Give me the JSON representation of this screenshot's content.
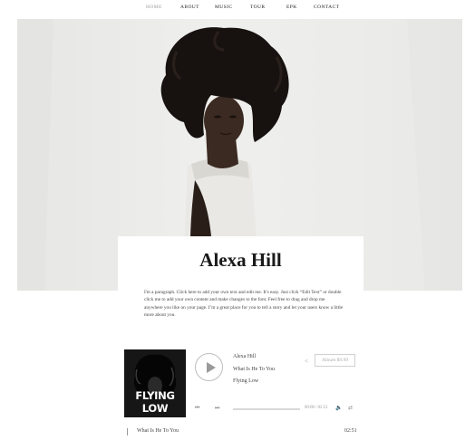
{
  "nav": {
    "items": [
      {
        "label": "HOME"
      },
      {
        "label": "ABOUT"
      },
      {
        "label": "MUSIC"
      },
      {
        "label": "TOUR"
      },
      {
        "label": "EPK"
      },
      {
        "label": "CONTACT"
      }
    ],
    "active_index": 0
  },
  "hero": {
    "image": "portrait-photo"
  },
  "artist": {
    "name": "Alexa Hill",
    "paragraph": "I'm a paragraph. Click here to add your own text and edit me. It's easy. Just click “Edit Text” or double click me to add your own content and make changes to the font. Feel free to drag and drop me anywhere you like on your page. I’m a great place for you to tell a story and let your users know a little more about you."
  },
  "player": {
    "cover_title": "FLYING LOW",
    "artist_name": "Alexa Hill",
    "track_title": "What Is He To You",
    "album_title": "Flying Low",
    "share_icon": "share-icon",
    "buy_label": "Album $9.99",
    "controls": {
      "prev_icon": "prev-icon",
      "next_icon": "next-icon",
      "volume_icon": "volume-icon",
      "shuffle_icon": "shuffle-icon"
    },
    "progress": 0,
    "time": "00:00 / 02:51"
  },
  "tracklist": [
    {
      "title": "What Is He To You",
      "duration": "02:51"
    }
  ],
  "colors": {
    "background": "#ffffff",
    "text": "#222222",
    "nav_active": "#9a9a9a",
    "hero_background": "#ececea"
  }
}
